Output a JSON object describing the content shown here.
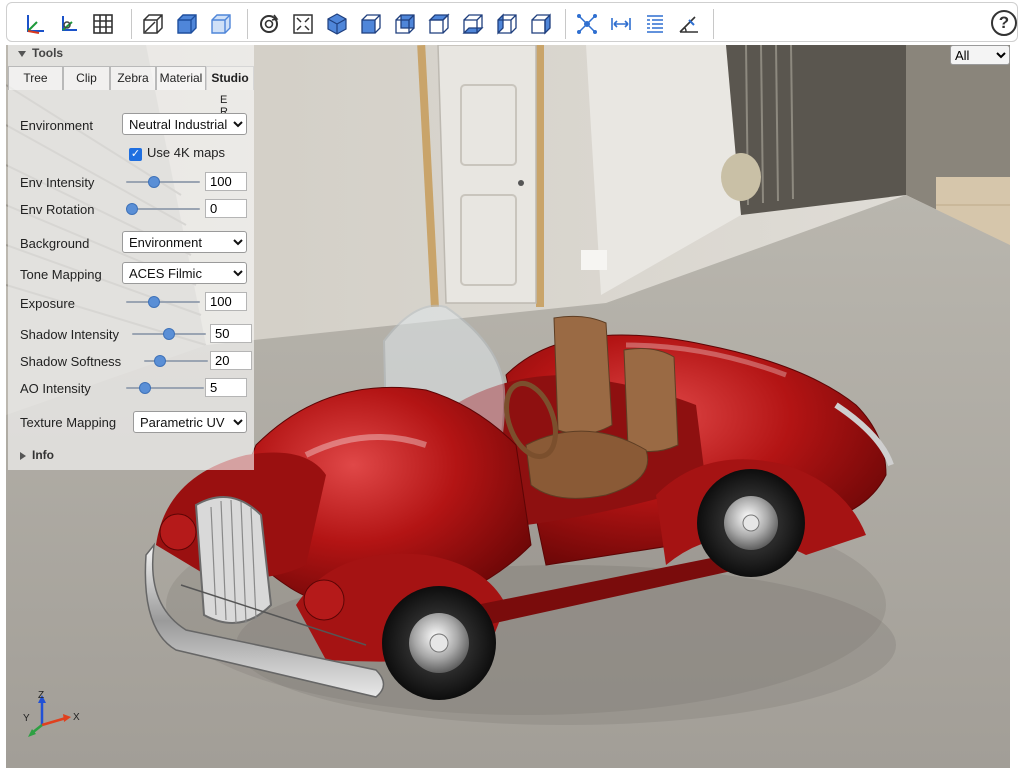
{
  "toolbar": {
    "icons": [
      "axes-icon",
      "axes0-icon",
      "grid-icon",
      "perspective-icon",
      "transparent-icon",
      "blackedges-icon",
      "reset-view-icon",
      "resize-icon",
      "iso-view-icon",
      "front-view-icon",
      "rear-view-icon",
      "top-view-icon",
      "bottom-view-icon",
      "left-view-icon",
      "right-view-icon",
      "explode-icon",
      "distance-icon",
      "properties-icon",
      "angle-icon",
      "help-icon"
    ],
    "help_label": "?"
  },
  "tools": {
    "header": "Tools",
    "tabs": [
      "Tree",
      "Clip",
      "Zebra",
      "Material",
      "Studio"
    ],
    "active_tab": "Studio",
    "er_label": "E R",
    "environment": {
      "label": "Environment",
      "value": "Neutral Industrial"
    },
    "use4k": {
      "label": "Use 4K maps",
      "checked": true
    },
    "env_intensity": {
      "label": "Env Intensity",
      "value": "100",
      "fraction": 0.35
    },
    "env_rotation": {
      "label": "Env Rotation",
      "value": "0",
      "fraction": 0.0
    },
    "background": {
      "label": "Background",
      "value": "Environment"
    },
    "tone_mapping": {
      "label": "Tone Mapping",
      "value": "ACES Filmic"
    },
    "exposure": {
      "label": "Exposure",
      "value": "100",
      "fraction": 0.35
    },
    "shadow_intensity": {
      "label": "Shadow Intensity",
      "value": "50",
      "fraction": 0.5
    },
    "shadow_softness": {
      "label": "Shadow Softness",
      "value": "20",
      "fraction": 0.2
    },
    "ao_intensity": {
      "label": "AO Intensity",
      "value": "5",
      "fraction": 0.2
    },
    "texture_mapping": {
      "label": "Texture Mapping",
      "value": "Parametric UV"
    },
    "info_label": "Info"
  },
  "view_select": {
    "value": "All"
  },
  "axes": {
    "z": "Z",
    "y": "Y",
    "x": "X"
  },
  "colors": {
    "accent": "#1f6fe0",
    "car_red": "#b01515",
    "seat_brown": "#9a6a44"
  }
}
